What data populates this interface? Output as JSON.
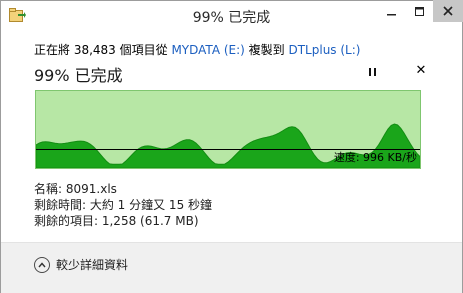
{
  "window": {
    "title": "99% 已完成"
  },
  "copy": {
    "prefix": "正在將 38,483 個項目從 ",
    "source": "MYDATA (E:)",
    "middle": " 複製到 ",
    "destination": "DTLplus (L:)",
    "progress_title": "99% 已完成",
    "percent_complete": 99
  },
  "graph": {
    "speed_label": "速度: 996 KB/秒",
    "colors": {
      "background": "#b7e7a5",
      "fill": "#1aa51a",
      "border": "#7fc66f"
    }
  },
  "info": {
    "name_line": "名稱: 8091.xls",
    "time_line": "剩餘時間: 大約 1 分鐘又 15 秒鐘",
    "items_line": "剩餘的項目: 1,258 (61.7 MB)"
  },
  "footer": {
    "details_label": "較少詳細資料"
  },
  "icons": {
    "minimize": "minimize-icon",
    "maximize": "maximize-icon",
    "close": "close-icon",
    "pause": "pause-icon",
    "cancel": "cancel-icon",
    "chevron": "chevron-up-icon"
  }
}
